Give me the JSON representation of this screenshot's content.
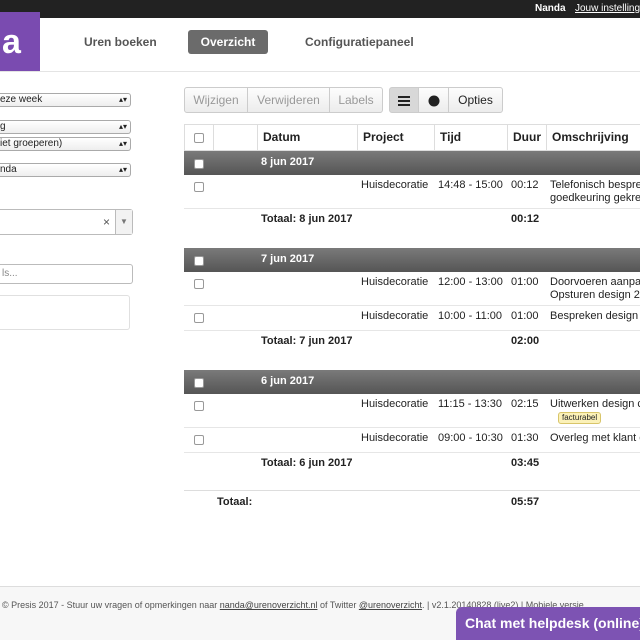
{
  "topbar": {
    "user": "Nanda",
    "settings_link": "Jouw instellingen"
  },
  "logo": {
    "text": "a"
  },
  "nav": {
    "uren_boeken": "Uren boeken",
    "overzicht": "Overzicht",
    "configuratiepaneel": "Configuratiepaneel"
  },
  "sidebar": {
    "period_select": "eze week",
    "group_select_1": "g",
    "group_select_2": "iet groeperen)",
    "user_select": "nda",
    "search_placeholder": "ls..."
  },
  "toolbar": {
    "wijzigen": "Wijzigen",
    "verwijderen": "Verwijderen",
    "labels": "Labels",
    "opties": "Opties",
    "list_icon": "list-icon",
    "dot_icon": "circle-icon"
  },
  "table": {
    "headers": {
      "datum": "Datum",
      "project": "Project",
      "tijd": "Tijd",
      "duur": "Duur",
      "omschrijving": "Omschrijving"
    },
    "groups": [
      {
        "date": "8 jun 2017",
        "rows": [
          {
            "project": "Huisdecoratie",
            "tijd": "14:48 - 15:00",
            "duur": "00:12",
            "omschrijving_1": "Telefonisch bespre",
            "omschrijving_2": "goedkeuring gekre"
          }
        ],
        "total_label": "Totaal: 8 jun 2017",
        "total": "00:12"
      },
      {
        "date": "7 jun 2017",
        "rows": [
          {
            "project": "Huisdecoratie",
            "tijd": "12:00 - 13:00",
            "duur": "01:00",
            "omschrijving_1": "Doorvoeren aanpa",
            "omschrijving_2": "Opsturen design 2"
          },
          {
            "project": "Huisdecoratie",
            "tijd": "10:00 - 11:00",
            "duur": "01:00",
            "omschrijving_1": "Bespreken design"
          }
        ],
        "total_label": "Totaal: 7 jun 2017",
        "total": "02:00"
      },
      {
        "date": "6 jun 2017",
        "rows": [
          {
            "project": "Huisdecoratie",
            "tijd": "11:15 - 13:30",
            "duur": "02:15",
            "omschrijving_1": "Uitwerken design c",
            "badge": "facturabel"
          },
          {
            "project": "Huisdecoratie",
            "tijd": "09:00 - 10:30",
            "duur": "01:30",
            "omschrijving_1": "Overleg met klant c"
          }
        ],
        "total_label": "Totaal: 6 jun 2017",
        "total": "03:45"
      }
    ],
    "grand_total_label": "Totaal:",
    "grand_total": "05:57"
  },
  "footer": {
    "copyright": "© Presis 2017 - Stuur uw vragen of opmerkingen naar",
    "email": "nanda@urenoverzicht.nl",
    "of_twitter": "of Twitter",
    "twitter": "@urenoverzicht",
    "version": ". | v2.1.20140828 (live2) | Mobiele versie"
  },
  "chat": {
    "label": "Chat met helpdesk (online)"
  }
}
